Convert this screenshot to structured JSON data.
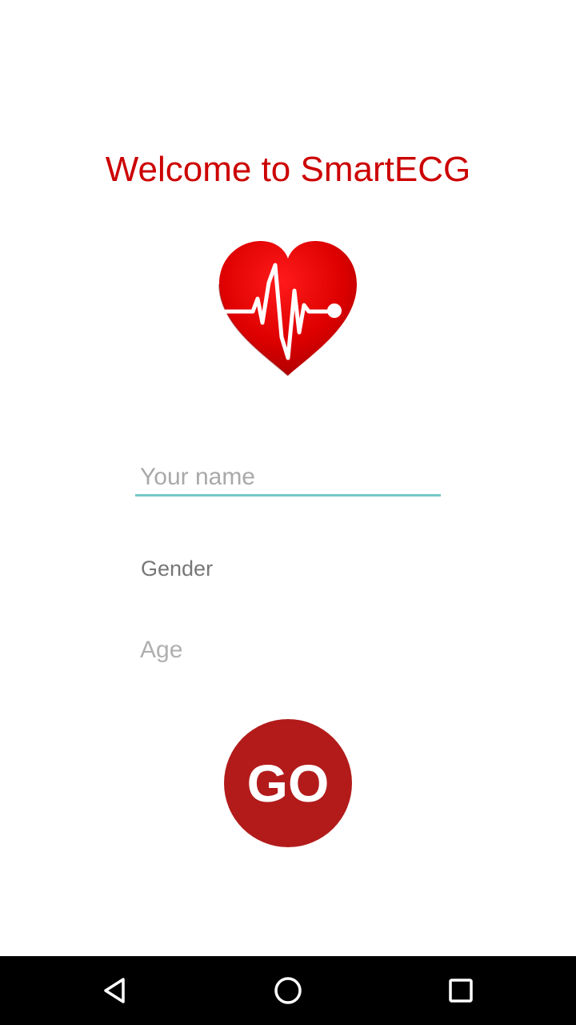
{
  "header": {
    "title": "Welcome to SmartECG"
  },
  "logo": {
    "icon": "heart-ecg-icon",
    "heart_color": "#e00000",
    "line_color": "#ffffff"
  },
  "form": {
    "name_placeholder": "Your name",
    "name_value": "",
    "gender_label": "Gender",
    "age_placeholder": "Age"
  },
  "go_button": {
    "label": "GO",
    "color": "#b31b1b"
  },
  "navbar": {
    "back_icon": "back-triangle-icon",
    "home_icon": "home-circle-icon",
    "recents_icon": "recents-square-icon"
  },
  "colors": {
    "title": "#cc0000",
    "input_underline": "#76c8c6",
    "navbar_bg": "#000000"
  }
}
